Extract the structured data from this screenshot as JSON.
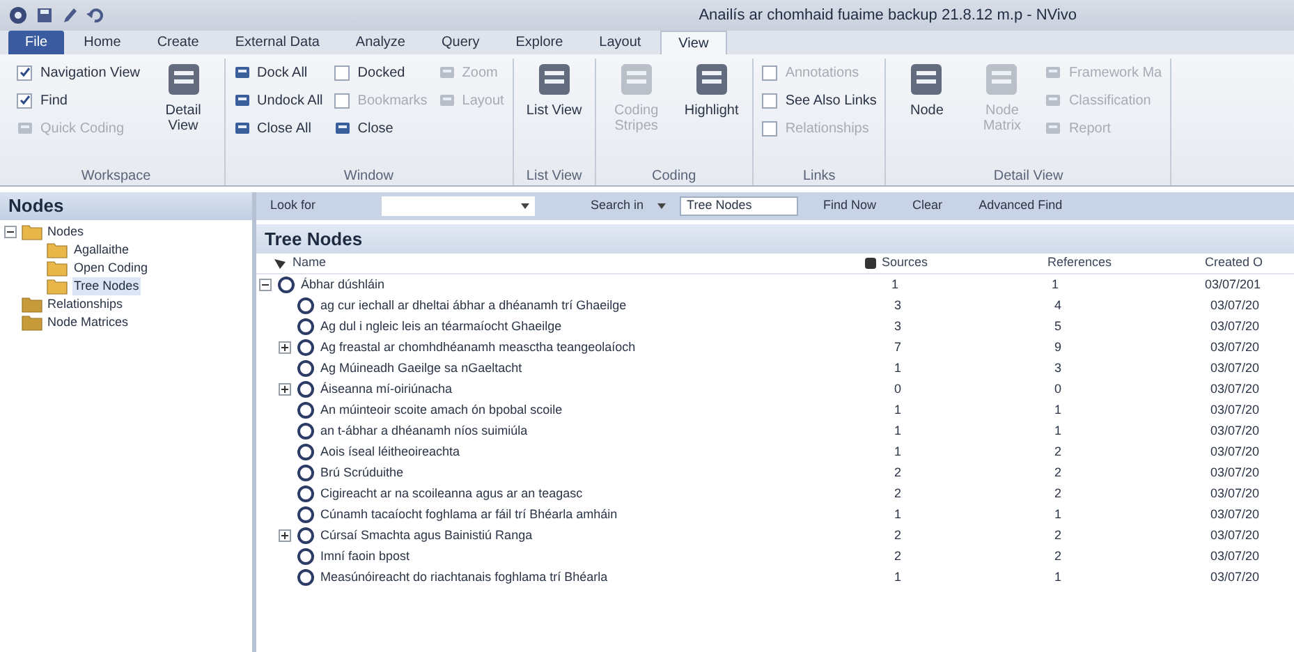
{
  "window": {
    "title": "Anailís ar chomhaid fuaime backup 21.8.12 m.p - NVivo"
  },
  "tabs": [
    {
      "label": "File",
      "selected": false,
      "kind": "file"
    },
    {
      "label": "Home",
      "selected": false
    },
    {
      "label": "Create",
      "selected": false
    },
    {
      "label": "External Data",
      "selected": false
    },
    {
      "label": "Analyze",
      "selected": false
    },
    {
      "label": "Query",
      "selected": false
    },
    {
      "label": "Explore",
      "selected": false
    },
    {
      "label": "Layout",
      "selected": false
    },
    {
      "label": "View",
      "selected": true
    }
  ],
  "ribbon": [
    {
      "label": "Workspace",
      "columns": [
        [
          {
            "kind": "checkbox",
            "label": "Navigation View",
            "checked": true,
            "disabled": false
          },
          {
            "kind": "checkbox",
            "label": "Find",
            "checked": true,
            "disabled": false
          },
          {
            "kind": "small",
            "label": "Quick Coding",
            "disabled": true
          }
        ],
        [
          {
            "kind": "large",
            "label": "Detail View",
            "disabled": false
          }
        ]
      ]
    },
    {
      "label": "Window",
      "columns": [
        [
          {
            "kind": "small",
            "label": "Dock All",
            "disabled": false
          },
          {
            "kind": "small",
            "label": "Undock All",
            "disabled": false
          },
          {
            "kind": "small",
            "label": "Close All",
            "disabled": false
          }
        ],
        [
          {
            "kind": "checkbox",
            "label": "Docked",
            "checked": false,
            "disabled": false
          },
          {
            "kind": "checkbox",
            "label": "Bookmarks",
            "checked": false,
            "disabled": true
          },
          {
            "kind": "small",
            "label": "Close",
            "disabled": false
          }
        ],
        [
          {
            "kind": "small",
            "label": "Zoom",
            "disabled": true
          },
          {
            "kind": "small",
            "label": "Layout",
            "disabled": true
          }
        ]
      ]
    },
    {
      "label": "List View",
      "columns": [
        [
          {
            "kind": "large",
            "label": "List View",
            "disabled": false
          }
        ]
      ]
    },
    {
      "label": "Coding",
      "columns": [
        [
          {
            "kind": "large",
            "label": "Coding Stripes",
            "disabled": true
          }
        ],
        [
          {
            "kind": "large",
            "label": "Highlight",
            "disabled": false
          }
        ]
      ]
    },
    {
      "label": "Links",
      "columns": [
        [
          {
            "kind": "checkbox",
            "label": "Annotations",
            "checked": false,
            "disabled": true
          },
          {
            "kind": "checkbox",
            "label": "See Also Links",
            "checked": false,
            "disabled": false
          },
          {
            "kind": "checkbox",
            "label": "Relationships",
            "checked": false,
            "disabled": true
          }
        ]
      ]
    },
    {
      "label": "Detail View",
      "columns": [
        [
          {
            "kind": "large",
            "label": "Node",
            "disabled": false
          }
        ],
        [
          {
            "kind": "large",
            "label": "Node Matrix",
            "disabled": true
          }
        ],
        [
          {
            "kind": "small",
            "label": "Framework Ma",
            "disabled": true
          },
          {
            "kind": "small",
            "label": "Classification",
            "disabled": true
          },
          {
            "kind": "small",
            "label": "Report",
            "disabled": true
          }
        ]
      ]
    }
  ],
  "sidebar": {
    "title": "Nodes",
    "items": [
      {
        "label": "Nodes",
        "expanded": true,
        "children": [
          {
            "label": "Agallaithe",
            "selected": false
          },
          {
            "label": "Open Coding",
            "selected": false
          },
          {
            "label": "Tree Nodes",
            "selected": true
          }
        ]
      },
      {
        "label": "Relationships"
      },
      {
        "label": "Node Matrices"
      }
    ]
  },
  "find_bar": {
    "look_for_label": "Look for",
    "search_in_label": "Search in",
    "search_in_value": "Tree Nodes",
    "buttons": [
      "Find Now",
      "Clear",
      "Advanced Find"
    ]
  },
  "table": {
    "title": "Tree Nodes",
    "columns": [
      "Name",
      "Sources",
      "References",
      "Created O"
    ],
    "rows": [
      {
        "name": "Ábhar dúshláin",
        "sources": "1",
        "references": "1",
        "created": "03/07/201",
        "expanded": true,
        "children": [
          {
            "name": "ag cur iechall ar dheltai ábhar a dhéanamh trí Ghaeilge",
            "sources": "3",
            "references": "4",
            "created": "03/07/20",
            "expandable": false
          },
          {
            "name": "Ag dul i ngleic leis an téarmaíocht Ghaeilge",
            "sources": "3",
            "references": "5",
            "created": "03/07/20",
            "expandable": false
          },
          {
            "name": "Ag freastal ar chomhdhéanamh measctha teangeolaíoch",
            "sources": "7",
            "references": "9",
            "created": "03/07/20",
            "expandable": true
          },
          {
            "name": "Ag Múineadh Gaeilge sa nGaeltacht",
            "sources": "1",
            "references": "3",
            "created": "03/07/20",
            "expandable": false
          },
          {
            "name": "Áiseanna mí-oiriúnacha",
            "sources": "0",
            "references": "0",
            "created": "03/07/20",
            "expandable": true
          },
          {
            "name": "An múinteoir scoite amach ón bpobal scoile",
            "sources": "1",
            "references": "1",
            "created": "03/07/20",
            "expandable": false
          },
          {
            "name": "an t-ábhar a dhéanamh níos suimiúla",
            "sources": "1",
            "references": "1",
            "created": "03/07/20",
            "expandable": false
          },
          {
            "name": "Aois íseal léitheoireachta",
            "sources": "1",
            "references": "2",
            "created": "03/07/20",
            "expandable": false
          },
          {
            "name": "Brú Scrúduithe",
            "sources": "2",
            "references": "2",
            "created": "03/07/20",
            "expandable": false
          },
          {
            "name": "Cigireacht ar na scoileanna agus ar an teagasc",
            "sources": "2",
            "references": "2",
            "created": "03/07/20",
            "expandable": false
          },
          {
            "name": "Cúnamh tacaíocht foghlama ar fáil trí Bhéarla amháin",
            "sources": "1",
            "references": "1",
            "created": "03/07/20",
            "expandable": false
          },
          {
            "name": "Cúrsaí Smachta agus Bainistiú Ranga",
            "sources": "2",
            "references": "2",
            "created": "03/07/20",
            "expandable": true
          },
          {
            "name": "Imní faoin bpost",
            "sources": "2",
            "references": "2",
            "created": "03/07/20",
            "expandable": false
          },
          {
            "name": "Measúnóireacht do riachtanais foghlama trí Bhéarla",
            "sources": "1",
            "references": "1",
            "created": "03/07/20",
            "expandable": false
          }
        ]
      }
    ]
  }
}
